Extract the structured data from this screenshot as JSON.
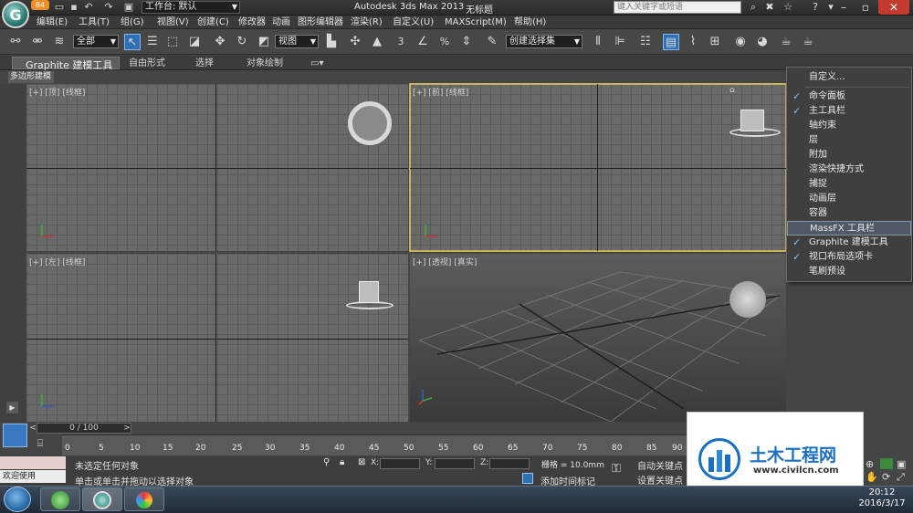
{
  "titlebar": {
    "badge": "84",
    "workspace_label": "工作台: 默认",
    "app_title": "Autodesk 3ds Max  2013",
    "doc_title": "无标题",
    "search_placeholder": "键入关键字或短语"
  },
  "menus": [
    "编辑(E)",
    "工具(T)",
    "组(G)",
    "视图(V)",
    "创建(C)",
    "修改器",
    "动画",
    "图形编辑器",
    "渲染(R)",
    "自定义(U)",
    "MAXScript(M)",
    "帮助(H)"
  ],
  "toolbar": {
    "selection_filter": "全部",
    "ref_coord": "视图",
    "named_selection": "创建选择集",
    "snap_3": "3",
    "snap_pct": "%"
  },
  "ribbon": {
    "tabs": [
      "Graphite 建模工具",
      "自由形式",
      "选择",
      "对象绘制"
    ],
    "subtab": "多边形建模"
  },
  "viewports": [
    {
      "label": "[+] [顶] [线框]"
    },
    {
      "label": "[+] [前] [线框]"
    },
    {
      "label": "[+] [左] [线框]"
    },
    {
      "label": "[+] [透视] [真实]"
    }
  ],
  "context_menu": {
    "items": [
      {
        "label": "自定义...",
        "checked": false
      },
      {
        "label": "命令面板",
        "checked": true
      },
      {
        "label": "主工具栏",
        "checked": true
      },
      {
        "label": "轴约束",
        "checked": false
      },
      {
        "label": "层",
        "checked": false
      },
      {
        "label": "附加",
        "checked": false
      },
      {
        "label": "渲染快捷方式",
        "checked": false
      },
      {
        "label": "捕捉",
        "checked": false
      },
      {
        "label": "动画层",
        "checked": false
      },
      {
        "label": "容器",
        "checked": false
      },
      {
        "label": "MassFX 工具栏",
        "checked": false,
        "highlighted": true
      },
      {
        "label": "Graphite 建模工具",
        "checked": true
      },
      {
        "label": "视口布局选项卡",
        "checked": true
      },
      {
        "label": "笔刷预设",
        "checked": false
      }
    ]
  },
  "timeline": {
    "slider": "0 / 100",
    "ticks": [
      "0",
      "5",
      "10",
      "15",
      "20",
      "25",
      "30",
      "35",
      "40",
      "45",
      "50",
      "55",
      "60",
      "65",
      "70",
      "75",
      "80",
      "85",
      "90"
    ]
  },
  "status": {
    "welcome": "欢迎使用 MAXSc",
    "selection": "未选定任何对象",
    "prompt": "单击或单击并拖动以选择对象",
    "x_label": "X:",
    "y_label": "Y:",
    "z_label": "Z:",
    "grid": "栅格 = 10.0mm",
    "add_time_tag": "添加时间标记",
    "auto_key": "自动关键点",
    "set_key": "设置关键点"
  },
  "watermark": {
    "title": "土木工程网",
    "url": "www.civilcn.com"
  },
  "taskbar": {
    "time": "20:12",
    "date": "2016/3/17"
  },
  "colors": {
    "accent_blue": "#2f6fb3",
    "active_viewport_border": "#c8b35a",
    "close_red": "#c23b2e",
    "watermark_blue": "#1c6fbf"
  }
}
